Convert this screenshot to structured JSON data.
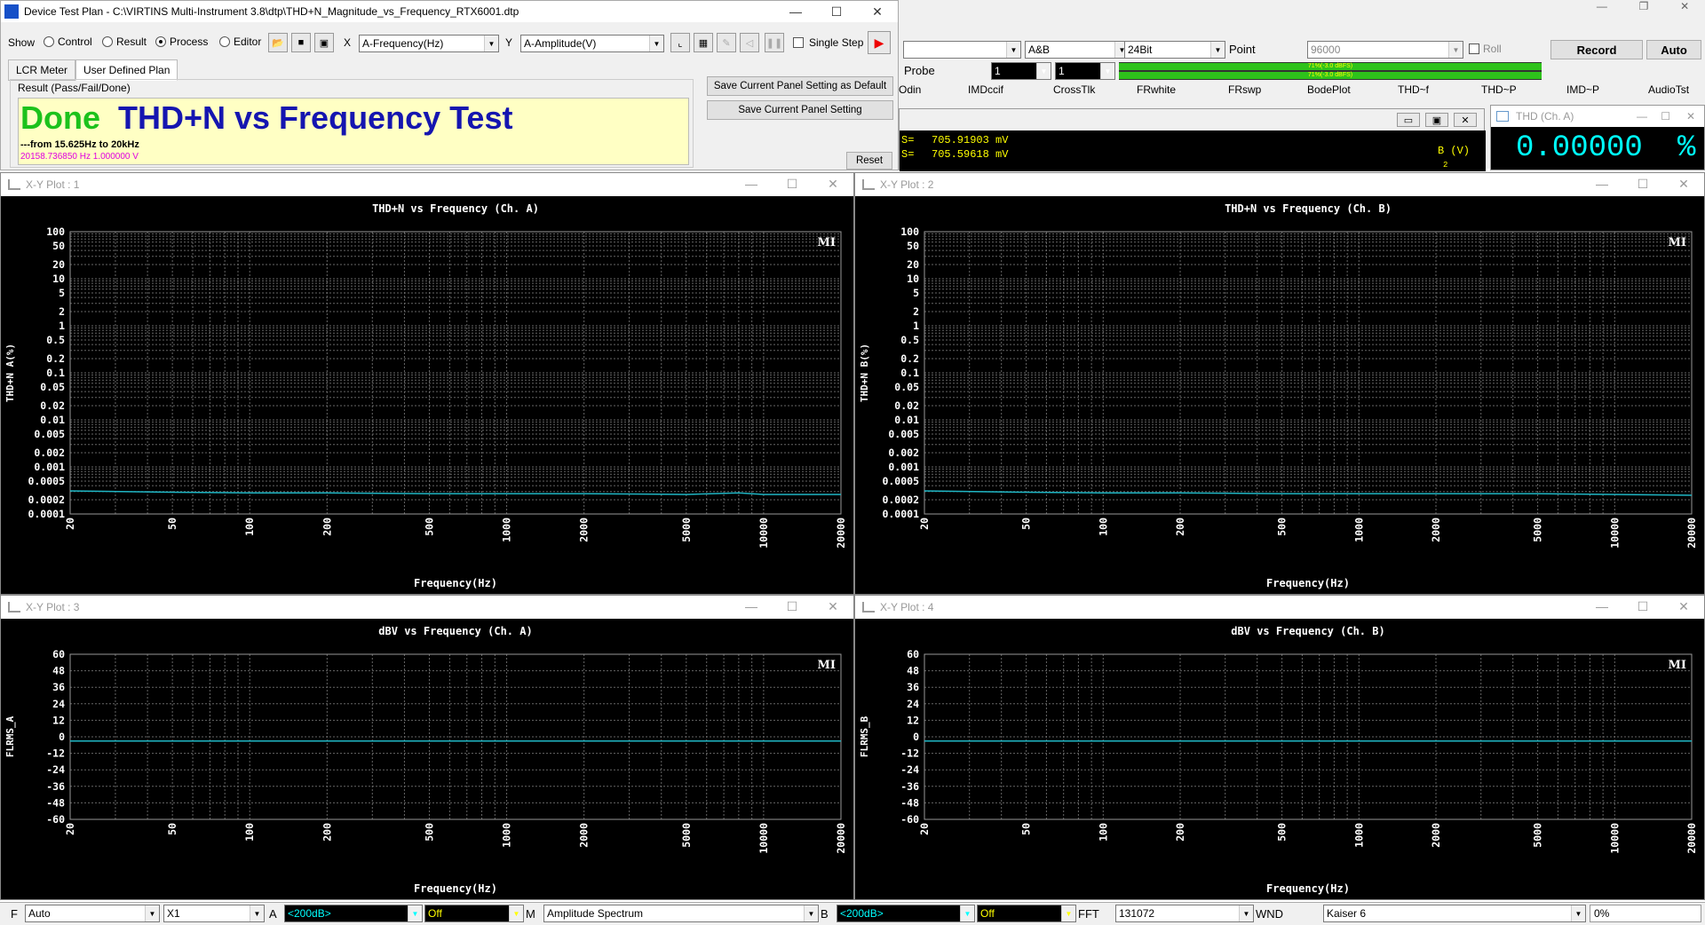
{
  "dtp": {
    "title": "Device Test Plan - C:\\VIRTINS Multi-Instrument 3.8\\dtp\\THD+N_Magnitude_vs_Frequency_RTX6001.dtp",
    "show_label": "Show",
    "radios": [
      "Control",
      "Result",
      "Process",
      "Editor"
    ],
    "x_label": "X",
    "x_value": "A-Frequency(Hz)",
    "y_label": "Y",
    "y_value": "A-Amplitude(V)",
    "single_step": "Single Step",
    "tabs": [
      "LCR Meter",
      "User Defined Plan"
    ],
    "result_group": "Result (Pass/Fail/Done)",
    "status": "Done",
    "headline": "THD+N vs Frequency Test",
    "subline": "---from 15.625Hz to 20kHz",
    "readout": "20158.736850 Hz   1.000000 V",
    "btn_save_default": "Save Current Panel Setting as Default",
    "btn_save": "Save Current Panel Setting",
    "btn_reset": "Reset"
  },
  "main": {
    "channel": "A&B",
    "bits": "24Bit",
    "point_label": "Point",
    "point": "96000",
    "roll": "Roll",
    "record": "Record",
    "auto": "Auto",
    "probe": "Probe",
    "probe_a": "1",
    "probe_b": "1",
    "level_a": "71%(-3.0 dBFS)",
    "level_b": "71%(-3.0 dBFS)",
    "tabs": [
      "Odin",
      "IMDccif",
      "CrossTlk",
      "FRwhite",
      "FRswp",
      "BodePlot",
      "THD~f",
      "THD~P",
      "IMD~P",
      "AudioTst"
    ],
    "rms_a_label": "S=",
    "rms_a": "705.91903",
    "rms_a_unit": "mV",
    "rms_b_label": "S=",
    "rms_b": "705.59618",
    "rms_b_unit": "mV",
    "rms_ch": "B (V)",
    "rms_small": "2"
  },
  "thd_meter": {
    "title": "THD (Ch. A)",
    "value": "0.00000",
    "unit": "%"
  },
  "plots": [
    {
      "window": "X-Y Plot : 1",
      "title": "THD+N vs Frequency (Ch. A)",
      "ylabel": "THD+N A(%)",
      "xlabel": "Frequency(Hz)",
      "badge": "MI"
    },
    {
      "window": "X-Y Plot : 2",
      "title": "THD+N vs Frequency (Ch. B)",
      "ylabel": "THD+N B(%)",
      "xlabel": "Frequency(Hz)",
      "badge": "MI"
    },
    {
      "window": "X-Y Plot : 3",
      "title": "dBV vs Frequency (Ch. A)",
      "ylabel": "FLRMS_A",
      "xlabel": "Frequency(Hz)",
      "badge": "MI"
    },
    {
      "window": "X-Y Plot : 4",
      "title": "dBV vs Frequency (Ch. B)",
      "ylabel": "FLRMS_B",
      "xlabel": "Frequency(Hz)",
      "badge": "MI"
    }
  ],
  "chart_data": [
    {
      "type": "line",
      "title": "THD+N vs Frequency (Ch. A)",
      "xlabel": "Frequency(Hz)",
      "ylabel": "THD+N A(%)",
      "xscale": "log",
      "yscale": "log",
      "xlim": [
        20,
        20000
      ],
      "ylim": [
        0.0001,
        100
      ],
      "grid": true,
      "x_ticks": [
        20,
        50,
        100,
        200,
        500,
        1000,
        2000,
        5000,
        10000,
        20000
      ],
      "y_ticks": [
        100,
        50,
        20,
        10,
        5,
        2,
        1,
        0.5,
        0.2,
        0.1,
        0.05,
        0.02,
        0.01,
        0.005,
        0.002,
        0.001,
        0.0005,
        0.0002,
        0.0001
      ],
      "series": [
        {
          "x": [
            20,
            50,
            100,
            200,
            500,
            1000,
            2000,
            5000,
            8000,
            10000,
            20000
          ],
          "y": [
            0.00031,
            0.00029,
            0.00028,
            0.00028,
            0.00027,
            0.00027,
            0.00027,
            0.00026,
            0.00028,
            0.00026,
            0.00026
          ]
        }
      ]
    },
    {
      "type": "line",
      "title": "THD+N vs Frequency (Ch. B)",
      "xlabel": "Frequency(Hz)",
      "ylabel": "THD+N B(%)",
      "xscale": "log",
      "yscale": "log",
      "xlim": [
        20,
        20000
      ],
      "ylim": [
        0.0001,
        100
      ],
      "grid": true,
      "x_ticks": [
        20,
        50,
        100,
        200,
        500,
        1000,
        2000,
        5000,
        10000,
        20000
      ],
      "y_ticks": [
        100,
        50,
        20,
        10,
        5,
        2,
        1,
        0.5,
        0.2,
        0.1,
        0.05,
        0.02,
        0.01,
        0.005,
        0.002,
        0.001,
        0.0005,
        0.0002,
        0.0001
      ],
      "series": [
        {
          "x": [
            20,
            50,
            100,
            200,
            500,
            1000,
            2000,
            5000,
            10000,
            20000
          ],
          "y": [
            0.00031,
            0.00029,
            0.00028,
            0.00028,
            0.00027,
            0.00027,
            0.00027,
            0.00027,
            0.00026,
            0.00025
          ]
        }
      ]
    },
    {
      "type": "line",
      "title": "dBV vs Frequency (Ch. A)",
      "xlabel": "Frequency(Hz)",
      "ylabel": "FLRMS_A",
      "xscale": "log",
      "xlim": [
        20,
        20000
      ],
      "ylim": [
        -60,
        60
      ],
      "grid": true,
      "x_ticks": [
        20,
        50,
        100,
        200,
        500,
        1000,
        2000,
        5000,
        10000,
        20000
      ],
      "y_ticks": [
        60,
        48,
        36,
        24,
        12,
        0,
        -12,
        -24,
        -36,
        -48,
        -60
      ],
      "series": [
        {
          "x": [
            20,
            20000
          ],
          "y": [
            -3,
            -3
          ]
        }
      ]
    },
    {
      "type": "line",
      "title": "dBV vs Frequency (Ch. B)",
      "xlabel": "Frequency(Hz)",
      "ylabel": "FLRMS_B",
      "xscale": "log",
      "xlim": [
        20,
        20000
      ],
      "ylim": [
        -60,
        60
      ],
      "grid": true,
      "x_ticks": [
        20,
        50,
        100,
        200,
        500,
        1000,
        2000,
        5000,
        10000,
        20000
      ],
      "y_ticks": [
        60,
        48,
        36,
        24,
        12,
        0,
        -12,
        -24,
        -36,
        -48,
        -60
      ],
      "series": [
        {
          "x": [
            20,
            20000
          ],
          "y": [
            -3,
            -3
          ]
        }
      ]
    }
  ],
  "statusbar": {
    "f_label": "F",
    "f": "Auto",
    "x1": "X1",
    "a_label": "A",
    "a_range": "<200dB>",
    "a_mode": "Off",
    "m_label": "M",
    "m": "Amplitude Spectrum",
    "b_label": "B",
    "b_range": "<200dB>",
    "b_mode": "Off",
    "fft_label": "FFT",
    "fft": "131072",
    "wnd_label": "WND",
    "wnd": "Kaiser 6",
    "pct": "0%"
  }
}
